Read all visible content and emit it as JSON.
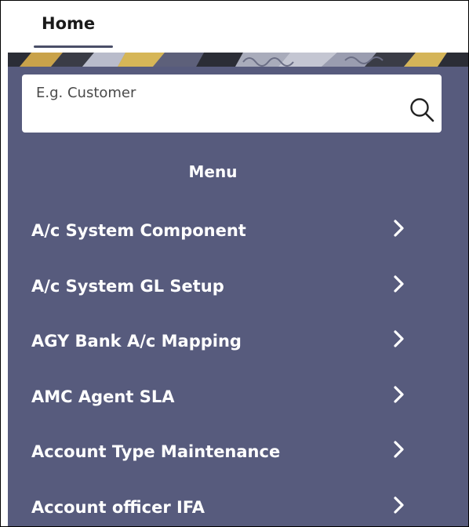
{
  "header": {
    "home_tab": "Home"
  },
  "search": {
    "placeholder": "E.g. Customer",
    "value": "",
    "icon": "search-icon"
  },
  "menu": {
    "title": "Menu",
    "items": [
      {
        "label": "A/c System Component",
        "icon": "chevron-right-icon"
      },
      {
        "label": "A/c System GL Setup",
        "icon": "chevron-right-icon"
      },
      {
        "label": "AGY Bank A/c Mapping",
        "icon": "chevron-right-icon"
      },
      {
        "label": "AMC Agent SLA",
        "icon": "chevron-right-icon"
      },
      {
        "label": "Account Type Maintenance",
        "icon": "chevron-right-icon"
      },
      {
        "label": "Account officer IFA",
        "icon": "chevron-right-icon"
      }
    ]
  },
  "colors": {
    "panel_background": "#575b7d",
    "menu_text": "#ffffff",
    "tab_underline": "#4a4f68"
  }
}
